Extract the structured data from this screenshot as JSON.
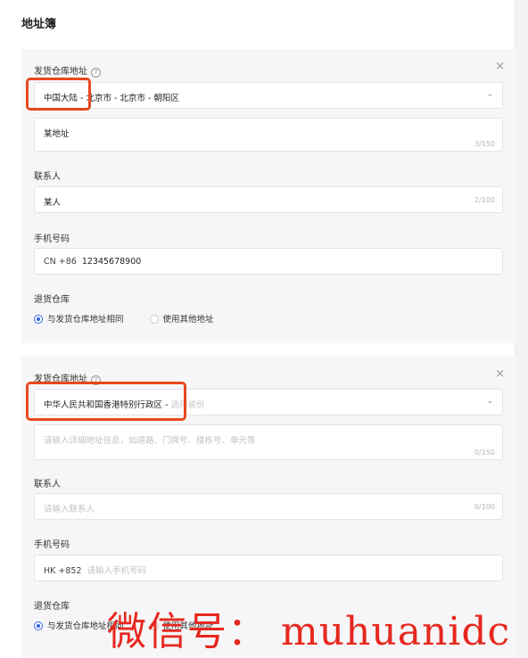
{
  "page": {
    "title": "地址簿"
  },
  "colors": {
    "highlight": "#e8491d",
    "radio_selected": "#2e63e6",
    "watermark": "#e6281e"
  },
  "card1": {
    "warehouse_label": "发货仓库地址",
    "region_value": "中国大陆 - 北京市 - 北京市 - 朝阳区",
    "address_value": "某地址",
    "address_counter": "3/150",
    "contact_label": "联系人",
    "contact_value": "某人",
    "contact_counter": "2/100",
    "phone_label": "手机号码",
    "phone_prefix": "CN +86",
    "phone_value": "12345678900",
    "return_label": "退货仓库",
    "option_same": "与发货仓库地址相同",
    "option_other": "使用其他地址"
  },
  "card2": {
    "warehouse_label": "发货仓库地址",
    "region_value": "中华人民共和国香港特别行政区 -",
    "region_placeholder": "选择省份",
    "address_placeholder": "请输入详细地址信息，如道路、门牌号、楼栋号、单元等",
    "address_counter": "0/150",
    "contact_label": "联系人",
    "contact_placeholder": "请输入联系人",
    "contact_counter": "0/100",
    "phone_label": "手机号码",
    "phone_prefix": "HK +852",
    "phone_placeholder": "请输入手机号码",
    "return_label": "退货仓库",
    "option_same": "与发货仓库地址相同",
    "option_other": "使用其他地址"
  },
  "icons": {
    "help": "?",
    "close": "×",
    "chevron": "⌄"
  },
  "watermark": "微信号： muhuanidc"
}
